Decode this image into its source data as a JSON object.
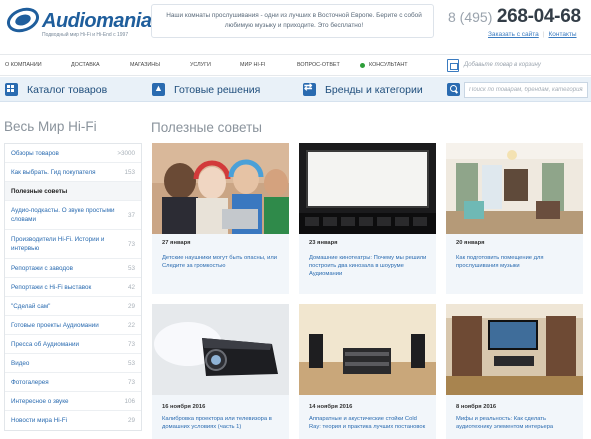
{
  "header": {
    "logo_name": "Audiomania",
    "logo_tagline": "Подводный мир Hi-Fi и Hi-End с 1997",
    "promo_text": "Наши комнаты прослушивания - одни из лучших в Восточной Европе. Берите с собой любимую музыку и приходите. Это бесплатно!",
    "phone_code": "8 (495)",
    "phone_number": "268-04-68",
    "link_order": "Заказать с сайта",
    "link_contacts": "Контакты"
  },
  "topnav": {
    "items": [
      "О компании",
      "Доставка",
      "Магазины",
      "Услуги",
      "Мир Hi-Fi",
      "Вопрос-ответ",
      "Консультант"
    ],
    "cart_text": "Добавьте товар в корзину"
  },
  "catbar": {
    "catalog": "Каталог товаров",
    "solutions": "Готовые решения",
    "brands": "Бренды и категории",
    "search_placeholder": "Поиск по товарам, брендам, категориям"
  },
  "sidebar": {
    "title": "Весь Мир Hi-Fi",
    "items": [
      {
        "label": "Обзоры товаров",
        "count": ">3000"
      },
      {
        "label": "Как выбрать. Гид покупателя",
        "count": "153"
      },
      {
        "label": "Полезные советы",
        "count": ""
      },
      {
        "label": "Аудио-подкасты. О звуке простыми словами",
        "count": "37"
      },
      {
        "label": "Производители Hi-Fi. Истории и интервью",
        "count": "73"
      },
      {
        "label": "Репортажи с заводов",
        "count": "53"
      },
      {
        "label": "Репортажи с Hi-Fi выставок",
        "count": "42"
      },
      {
        "label": "\"Сделай сам\"",
        "count": "29"
      },
      {
        "label": "Готовые проекты Аудиомании",
        "count": "22"
      },
      {
        "label": "Пресса об Аудиомании",
        "count": "73"
      },
      {
        "label": "Видео",
        "count": "53"
      },
      {
        "label": "Фотогалерея",
        "count": "73"
      },
      {
        "label": "Интересное о звуке",
        "count": "106"
      },
      {
        "label": "Новости мира Hi-Fi",
        "count": "29"
      }
    ]
  },
  "main": {
    "title": "Полезные советы",
    "cards": [
      {
        "date": "27 января",
        "title": "Детские наушники могут быть опасны, или Следите за громкостью"
      },
      {
        "date": "23 января",
        "title": "Домашние кинотеатры: Почему мы решили построить два кинозала в шоуруме Аудиомании"
      },
      {
        "date": "20 января",
        "title": "Как подготовить помещение для прослушивания музыки"
      },
      {
        "date": "16 ноября 2016",
        "title": "Калибровка проектора или телевизора в домашних условиях (часть 1)"
      },
      {
        "date": "14 ноября 2016",
        "title": "Аппаратные и акустические стойки Cold Ray: теория и практика лучших постановок"
      },
      {
        "date": "8 ноября 2016",
        "title": "Мифы и реальность: Как сделать аудиотехнику элементом интерьера"
      }
    ]
  },
  "colors": {
    "brand_blue": "#2a6bb0",
    "bar_bg": "#e9f1f8",
    "consultant_green": "#2e9e3a"
  }
}
